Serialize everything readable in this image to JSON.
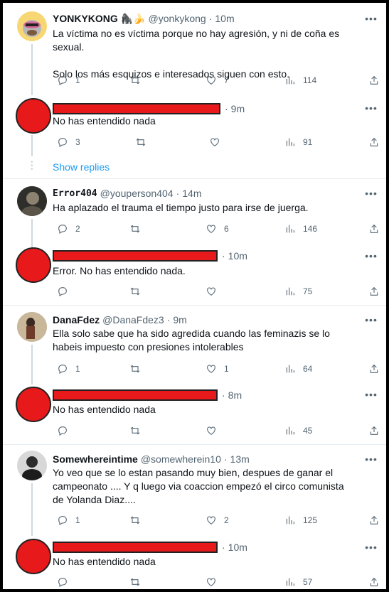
{
  "show_replies_label": "Show replies",
  "posts": [
    {
      "name": "YONKYKONG 🦍🍌",
      "handle": "@yonkykong",
      "sep": "·",
      "time": "10m",
      "text": "La víctima no es víctima porque no hay agresión, y ni de coña es sexual.\n\nSolo los más esquizos e interesados siguen con esto.",
      "replies": "1",
      "retweets": "",
      "likes": "7",
      "views": "114"
    },
    {
      "name": "",
      "handle": "",
      "sep": "·",
      "time": "9m",
      "text": "No has entendido nada",
      "replies": "3",
      "retweets": "",
      "likes": "",
      "views": "91"
    },
    {
      "name": "Error404",
      "handle": "@youperson404",
      "sep": "·",
      "time": "14m",
      "text": "Ha aplazado el trauma el tiempo justo para irse de juerga.",
      "replies": "2",
      "retweets": "",
      "likes": "6",
      "views": "146"
    },
    {
      "name": "",
      "handle": "",
      "sep": "·",
      "time": "10m",
      "text": "Error. No has entendido nada.",
      "replies": "",
      "retweets": "",
      "likes": "",
      "views": "75"
    },
    {
      "name": "DanaFdez",
      "handle": "@DanaFdez3",
      "sep": "·",
      "time": "9m",
      "text": "Ella solo sabe que ha sido agredida cuando las feminazis se lo habeis impuesto con presiones intolerables",
      "replies": "1",
      "retweets": "",
      "likes": "1",
      "views": "64"
    },
    {
      "name": "",
      "handle": "",
      "sep": "·",
      "time": "8m",
      "text": "No has entendido nada",
      "replies": "",
      "retweets": "",
      "likes": "",
      "views": "45"
    },
    {
      "name": "Somewhereintime",
      "handle": "@somewherein10",
      "sep": "·",
      "time": "13m",
      "text": "Yo veo que se lo estan pasando muy bien, despues de ganar el campeonato .... Y q luego via coaccion empezó el circo comunista de Yolanda Diaz....",
      "replies": "1",
      "retweets": "",
      "likes": "2",
      "views": "125"
    },
    {
      "name": "",
      "handle": "",
      "sep": "·",
      "time": "10m",
      "text": "No has entendido nada",
      "replies": "",
      "retweets": "",
      "likes": "",
      "views": "57"
    }
  ]
}
